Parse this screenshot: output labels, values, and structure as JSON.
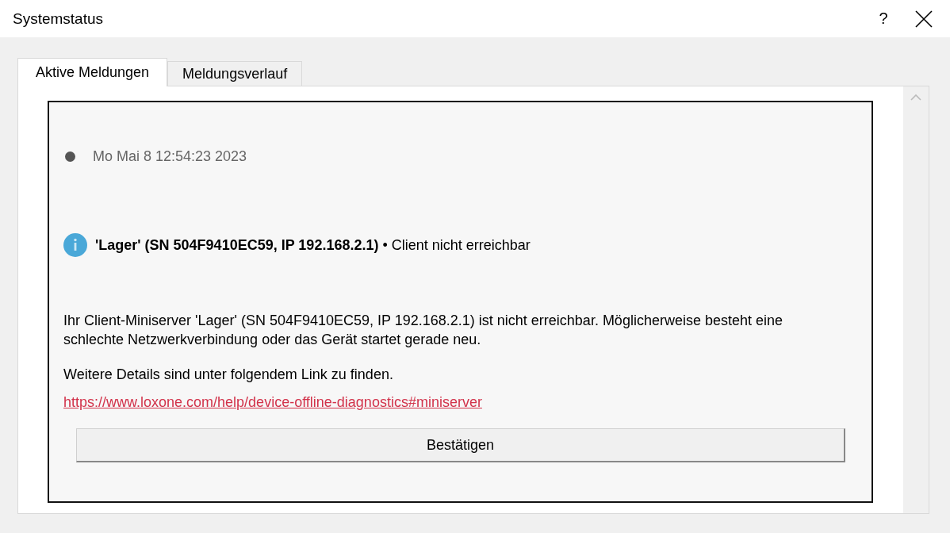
{
  "window": {
    "title": "Systemstatus",
    "help": "?"
  },
  "tabs": [
    {
      "label": "Aktive Meldungen",
      "selected": true
    },
    {
      "label": "Meldungsverlauf",
      "selected": false
    }
  ],
  "message": {
    "timestamp": "Mo Mai 8 12:54:23 2023",
    "headline": "**'Lager' (SN 504F9410EC59, IP 192.168.2.1)** • Client nicht erreichbar",
    "description": "Ihr Client-Miniserver 'Lager' (SN 504F9410EC59, IP 192.168.2.1) ist nicht erreichbar. Möglicherweise besteht eine schlechte Netzwerkverbindung oder das Gerät startet gerade neu.",
    "details": "Weitere Details sind unter folgendem Link zu finden.",
    "link": "https://www.loxone.com/help/device-offline-diagnostics#miniserver",
    "button": "Bestätigen"
  }
}
